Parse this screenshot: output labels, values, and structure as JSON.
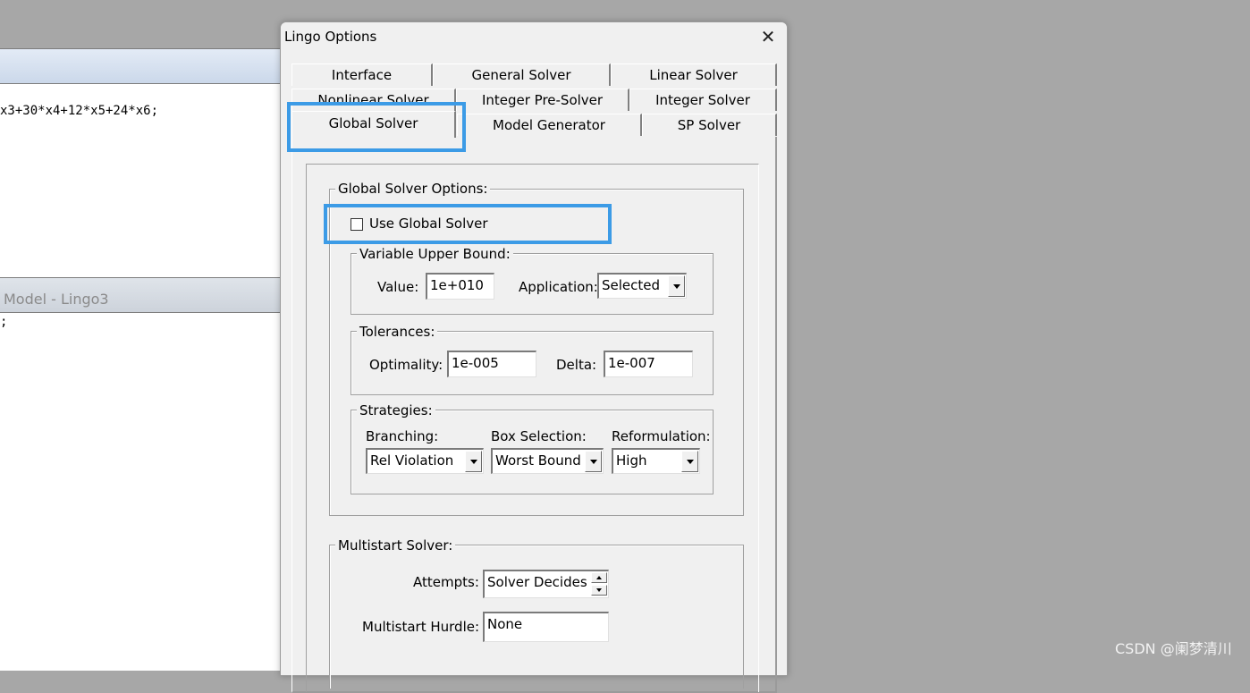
{
  "background_windows": {
    "top_code": "x3+30*x4+12*x5+24*x6;",
    "bottom_title": "Model - Lingo3",
    "bottom_code": ";"
  },
  "dialog": {
    "title": "Lingo Options",
    "close_glyph": "✕",
    "tabs_row1": [
      "Interface",
      "General Solver",
      "Linear Solver"
    ],
    "tabs_row2": [
      "Nonlinear Solver",
      "Integer Pre-Solver",
      "Integer Solver"
    ],
    "tabs_row3": [
      "Global Solver",
      "Model Generator",
      "SP Solver"
    ],
    "selected_tab": "Global Solver",
    "global_options": {
      "group_label": "Global Solver Options:",
      "use_global_label": "Use Global Solver",
      "use_global_checked": false,
      "vub": {
        "group_label": "Variable Upper Bound:",
        "value_label": "Value:",
        "value": "1e+010",
        "application_label": "Application:",
        "application_value": "Selected"
      },
      "tolerances": {
        "group_label": "Tolerances:",
        "optimality_label": "Optimality:",
        "optimality_value": "1e-005",
        "delta_label": "Delta:",
        "delta_value": "1e-007"
      },
      "strategies": {
        "group_label": "Strategies:",
        "branching_label": "Branching:",
        "branching_value": "Rel Violation",
        "box_label": "Box Selection:",
        "box_value": "Worst Bound",
        "reform_label": "Reformulation:",
        "reform_value": "High"
      }
    },
    "multistart": {
      "group_label": "Multistart Solver:",
      "attempts_label": "Attempts:",
      "attempts_value": "Solver Decides",
      "hurdle_label": "Multistart Hurdle:",
      "hurdle_value": "None"
    }
  },
  "watermark": "CSDN @阑梦清川",
  "colors": {
    "highlight": "#3c9be6",
    "desktop": "#a7a7a7"
  }
}
